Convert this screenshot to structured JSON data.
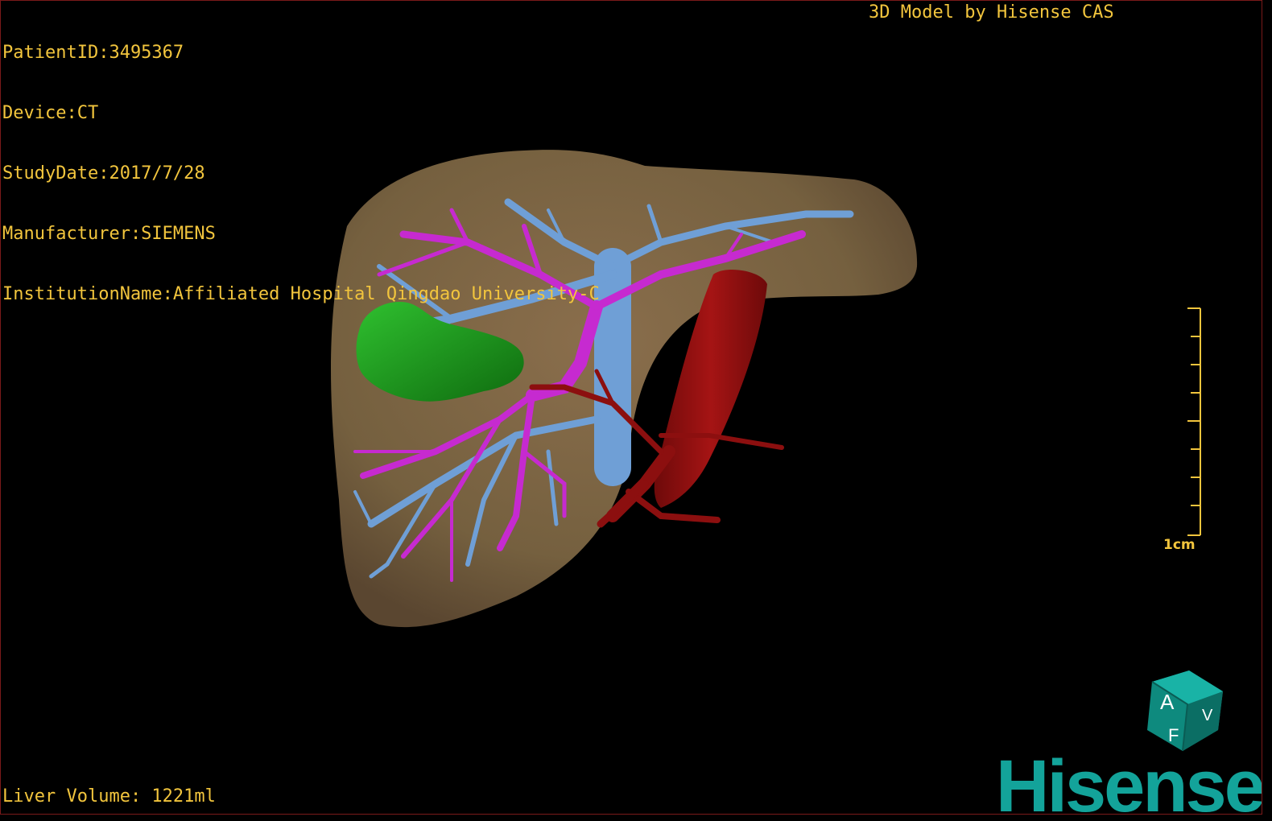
{
  "overlay": {
    "patient_id": "PatientID:3495367",
    "device": "Device:CT",
    "study_date": "StudyDate:2017/7/28",
    "manufacturer": "Manufacturer:SIEMENS",
    "institution": "InstitutionName:Affiliated Hospital Qingdao University-C",
    "credit": "3D Model by Hisense CAS",
    "liver_volume": "Liver Volume: 1221ml"
  },
  "scale_bar": {
    "label": "1cm"
  },
  "orientation_cube": {
    "face_front": "A",
    "face_bottom": "F",
    "face_side": "V"
  },
  "brand": {
    "logo_text": "Hisense",
    "color": "#13a39a"
  },
  "colors": {
    "liver": "#7d6444",
    "portal_vein": "#6f9fd6",
    "hepatic_vein": "#c62ad0",
    "gallbladder": "#1a8f1a",
    "artery": "#8c0f0f",
    "overlay_text": "#f2c53d"
  }
}
